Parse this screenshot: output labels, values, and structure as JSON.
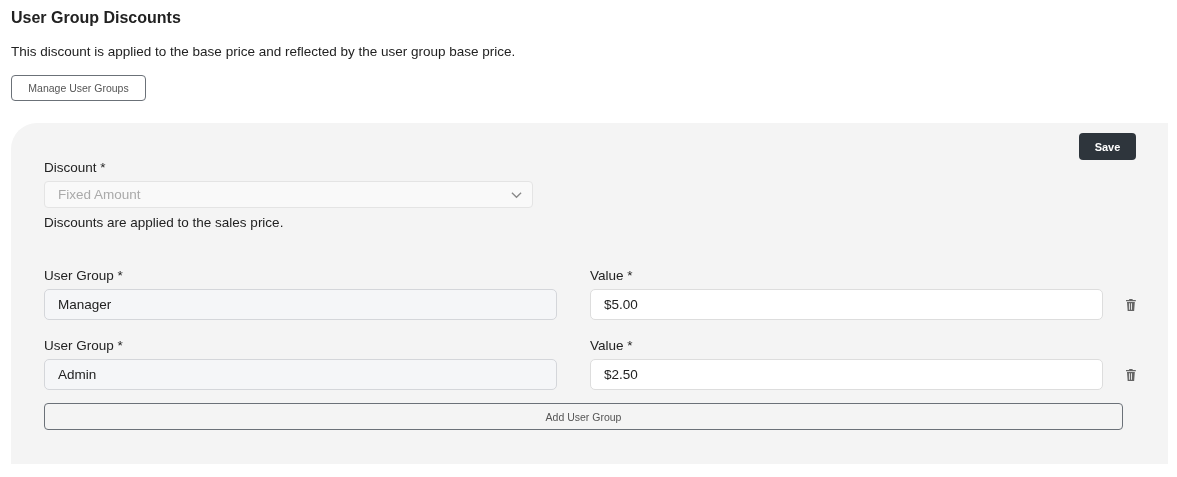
{
  "title": "User Group Discounts",
  "description": "This discount is applied to the base price and reflected by the user group base price.",
  "manage_button": "Manage User Groups",
  "panel": {
    "save_button": "Save",
    "discount": {
      "label": "Discount *",
      "value": "Fixed Amount",
      "disabled": true,
      "help": "Discounts are applied to the sales price."
    },
    "rows": [
      {
        "group_label": "User Group *",
        "group_value": "Manager",
        "value_label": "Value *",
        "value": "$5.00"
      },
      {
        "group_label": "User Group *",
        "group_value": "Admin",
        "value_label": "Value *",
        "value": "$2.50"
      }
    ],
    "add_button": "Add User Group"
  }
}
